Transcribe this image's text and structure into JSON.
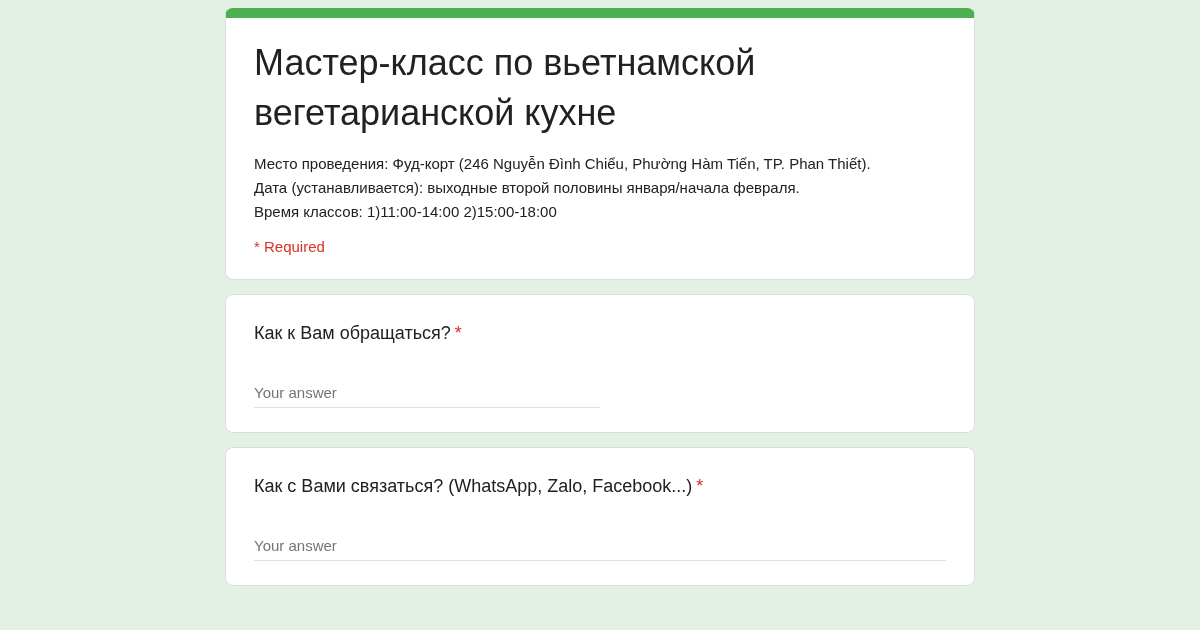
{
  "form": {
    "title": "Мастер-класс по вьетнамской вегетарианской кухне",
    "description": [
      "Место проведения: Фуд-корт (246 Nguyễn Đình Chiểu, Phường Hàm Tiến, TP. Phan Thiết).",
      "Дата (устанавливается): выходные второй половины января/начала февраля.",
      "Время классов: 1)11:00-14:00 2)15:00-18:00"
    ],
    "required_note": "* Required"
  },
  "questions": [
    {
      "label": "Как к Вам обращаться?",
      "required_mark": "*",
      "kind": "short",
      "placeholder": "Your answer"
    },
    {
      "label": "Как с Вами связаться? (WhatsApp, Zalo, Facebook...)",
      "required_mark": "*",
      "kind": "paragraph",
      "placeholder": "Your answer"
    }
  ]
}
